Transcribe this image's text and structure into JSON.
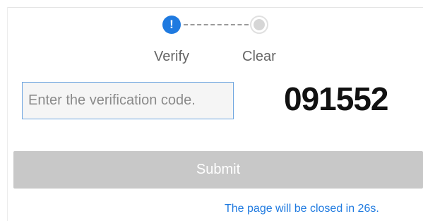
{
  "stepper": {
    "active_icon": "exclamation-icon",
    "pending_icon": "empty-circle-icon",
    "steps": [
      {
        "label": "Verify",
        "state": "active"
      },
      {
        "label": "Clear",
        "state": "pending"
      }
    ],
    "active_icon_glyph": "!",
    "accent_color": "#1f7ae0"
  },
  "verification": {
    "placeholder": "Enter the verification code.",
    "value": "",
    "code": "091552"
  },
  "submit": {
    "label": "Submit",
    "enabled": false
  },
  "footer": {
    "close_notice": "The page will be closed in 26s."
  }
}
